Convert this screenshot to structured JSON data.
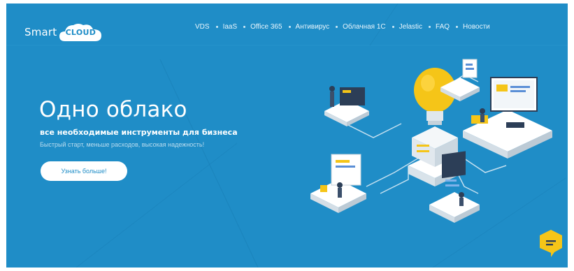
{
  "header": {
    "logo": {
      "smart": "Smart",
      "cloud": "CLOUD"
    },
    "nav": [
      {
        "label": "VDS"
      },
      {
        "label": "IaaS"
      },
      {
        "label": "Office 365"
      },
      {
        "label": "Антивирус"
      },
      {
        "label": "Облачная 1С"
      },
      {
        "label": "Jelastic"
      },
      {
        "label": "FAQ"
      },
      {
        "label": "Новости"
      }
    ]
  },
  "hero": {
    "title": "Одно облако",
    "subtitle": "все необходимые инструменты для бизнеса",
    "tagline": "Быстрый старт, меньше расходов, высокая надежность!",
    "cta_label": "Узнать больше!"
  },
  "colors": {
    "background": "#1f8dc7",
    "accent": "#f5c518",
    "text": "#ffffff"
  },
  "icons": {
    "chat": "chat-bubble-icon",
    "illustration": "isometric-cloud-infrastructure"
  }
}
